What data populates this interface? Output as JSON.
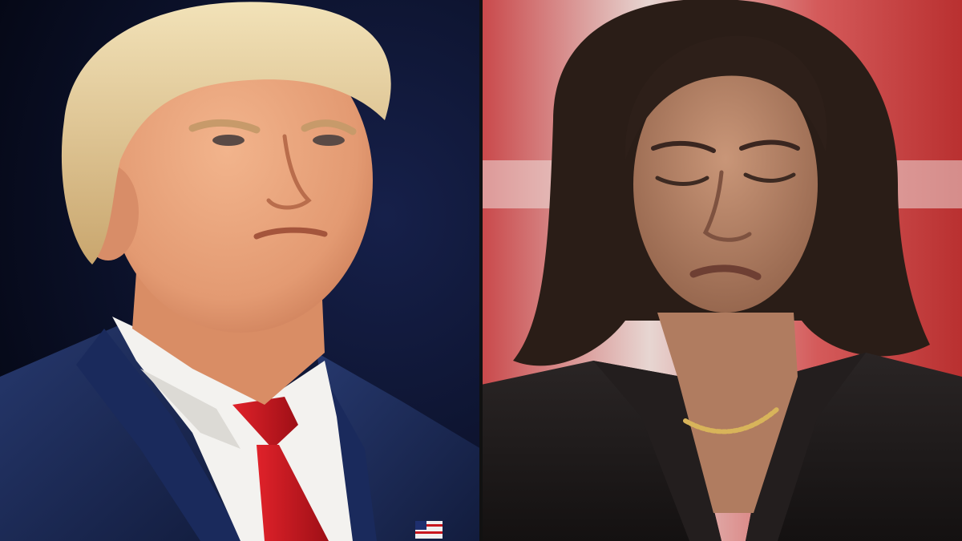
{
  "image": {
    "layout": "side-by-side-split",
    "panels": [
      {
        "subject": "man-in-navy-suit-red-tie",
        "background": "dark-navy-stage"
      },
      {
        "subject": "woman-in-dark-blazer-looking-down",
        "background": "red-white-signage"
      }
    ]
  },
  "colors": {
    "left_bg": "#0a1230",
    "suit_navy": "#1c2a55",
    "tie_red": "#c8161e",
    "shirt_white": "#f2f1ee",
    "skin_left": "#e9a27c",
    "hair_left": "#e6cf9c",
    "right_bg_red": "#c23a3a",
    "right_bg_light": "#efe6e2",
    "hair_right": "#2a1d17",
    "skin_right": "#b9876a",
    "blazer_dark": "#1b1818",
    "necklace_gold": "#d8b45a"
  }
}
